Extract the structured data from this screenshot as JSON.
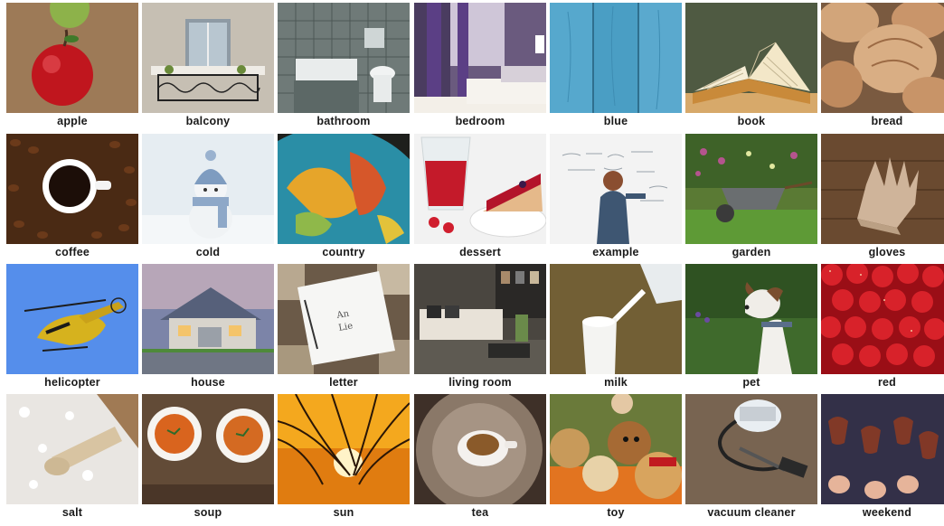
{
  "cards": [
    {
      "label": "apple",
      "icon": "apple-image"
    },
    {
      "label": "balcony",
      "icon": "balcony-image"
    },
    {
      "label": "bathroom",
      "icon": "bathroom-image"
    },
    {
      "label": "bedroom",
      "icon": "bedroom-image"
    },
    {
      "label": "blue",
      "icon": "blue-wood-image"
    },
    {
      "label": "book",
      "icon": "book-image"
    },
    {
      "label": "bread",
      "icon": "bread-image"
    },
    {
      "label": "coffee",
      "icon": "coffee-image"
    },
    {
      "label": "cold",
      "icon": "cold-image"
    },
    {
      "label": "country",
      "icon": "globe-image"
    },
    {
      "label": "dessert",
      "icon": "dessert-image"
    },
    {
      "label": "example",
      "icon": "whiteboard-image"
    },
    {
      "label": "garden",
      "icon": "garden-image"
    },
    {
      "label": "gloves",
      "icon": "gloves-image"
    },
    {
      "label": "helicopter",
      "icon": "helicopter-image"
    },
    {
      "label": "house",
      "icon": "house-image"
    },
    {
      "label": "letter",
      "icon": "letter-image"
    },
    {
      "label": "living room",
      "icon": "living-room-image"
    },
    {
      "label": "milk",
      "icon": "milk-image"
    },
    {
      "label": "pet",
      "icon": "dog-image"
    },
    {
      "label": "red",
      "icon": "strawberries-image"
    },
    {
      "label": "salt",
      "icon": "salt-image"
    },
    {
      "label": "soup",
      "icon": "soup-image"
    },
    {
      "label": "sun",
      "icon": "sunset-image"
    },
    {
      "label": "tea",
      "icon": "tea-image"
    },
    {
      "label": "toy",
      "icon": "teddy-bears-image"
    },
    {
      "label": "vacuum cleaner",
      "icon": "vacuum-cleaner-image"
    },
    {
      "label": "weekend",
      "icon": "wine-glasses-image"
    }
  ]
}
